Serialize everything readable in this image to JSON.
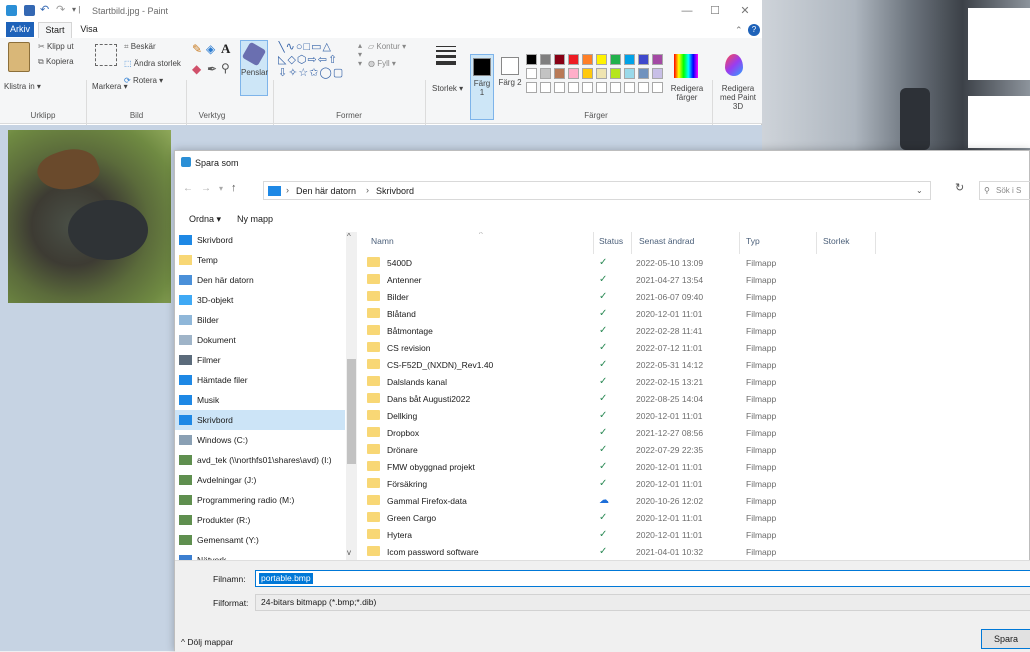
{
  "app": {
    "title": "Startbild.jpg - Paint"
  },
  "menu": {
    "tabs": [
      "Arkiv",
      "Start",
      "Visa"
    ]
  },
  "ribbon": {
    "klistra": "Klistra in ▾",
    "klipp_ut": "Klipp ut",
    "kopiera": "Kopiera",
    "markera": "Markera ▾",
    "beskar": "Beskär",
    "andra_storlek": "Ändra storlek",
    "rotera": "Rotera ▾",
    "penslar": "Penslar",
    "kontur": "Kontur ▾",
    "fyll": "Fyll ▾",
    "storlek": "Storlek ▾",
    "farg1": "Färg 1",
    "farg2": "Färg 2",
    "redigera_farger": "Redigera färger",
    "redigera_3d": "Redigera med Paint 3D",
    "groups": {
      "urklipp": "Urklipp",
      "bild": "Bild",
      "verktyg": "Verktyg",
      "former": "Former",
      "farger": "Färger"
    },
    "palette": [
      "#000000",
      "#7f7f7f",
      "#880015",
      "#ed1c24",
      "#ff7f27",
      "#fff200",
      "#22b14c",
      "#00a2e8",
      "#3f48cc",
      "#a349a4",
      "#ffffff",
      "#c3c3c3",
      "#b97a57",
      "#ffaec9",
      "#ffc90e",
      "#efe4b0",
      "#b5e61d",
      "#99d9ea",
      "#7092be",
      "#c8bfe7"
    ]
  },
  "dialog": {
    "title": "Spara som",
    "breadcrumb": [
      "Den här datorn",
      "Skrivbord"
    ],
    "search_placeholder": "Sök i S",
    "cmd": {
      "ordna": "Ordna ▾",
      "ny_mapp": "Ny mapp"
    },
    "nav": [
      {
        "label": "Skrivbord",
        "icon": "desktop-icon",
        "color": "#1e88e5",
        "sel": false
      },
      {
        "label": "Temp",
        "icon": "folder-icon",
        "color": "#f8d775",
        "sel": false
      },
      {
        "label": "Den här datorn",
        "icon": "computer-icon",
        "color": "#4a90d9",
        "sel": false
      },
      {
        "label": "3D-objekt",
        "icon": "cube-icon",
        "color": "#3fa9f5",
        "sel": false
      },
      {
        "label": "Bilder",
        "icon": "pictures-icon",
        "color": "#8fb7d9",
        "sel": false
      },
      {
        "label": "Dokument",
        "icon": "document-icon",
        "color": "#9fb4c8",
        "sel": false
      },
      {
        "label": "Filmer",
        "icon": "film-icon",
        "color": "#5b6b7b",
        "sel": false
      },
      {
        "label": "Hämtade filer",
        "icon": "download-icon",
        "color": "#1e88e5",
        "sel": false
      },
      {
        "label": "Musik",
        "icon": "music-icon",
        "color": "#1e88e5",
        "sel": false
      },
      {
        "label": "Skrivbord",
        "icon": "desktop-icon",
        "color": "#1e88e5",
        "sel": true
      },
      {
        "label": "Windows (C:)",
        "icon": "drive-icon",
        "color": "#8aa0b4",
        "sel": false
      },
      {
        "label": "avd_tek (\\\\northfs01\\shares\\avd) (I:)",
        "icon": "network-drive-icon",
        "color": "#5f8f4f",
        "sel": false
      },
      {
        "label": "Avdelningar (J:)",
        "icon": "network-drive-icon",
        "color": "#5f8f4f",
        "sel": false
      },
      {
        "label": "Programmering radio (M:)",
        "icon": "network-drive-icon",
        "color": "#5f8f4f",
        "sel": false
      },
      {
        "label": "Produkter (R:)",
        "icon": "network-drive-icon",
        "color": "#5f8f4f",
        "sel": false
      },
      {
        "label": "Gemensamt (Y:)",
        "icon": "network-drive-icon",
        "color": "#5f8f4f",
        "sel": false
      },
      {
        "label": "Nätverk",
        "icon": "network-icon",
        "color": "#3c7fd0",
        "sel": false
      }
    ],
    "columns": [
      "Namn",
      "Status",
      "Senast ändrad",
      "Typ",
      "Storlek"
    ],
    "files": [
      {
        "name": "5400D",
        "status": "✓",
        "date": "2022-05-10 13:09",
        "type": "Filmapp"
      },
      {
        "name": "Antenner",
        "status": "✓",
        "date": "2021-04-27 13:54",
        "type": "Filmapp"
      },
      {
        "name": "Bilder",
        "status": "✓",
        "date": "2021-06-07 09:40",
        "type": "Filmapp"
      },
      {
        "name": "Blåtand",
        "status": "✓",
        "date": "2020-12-01 11:01",
        "type": "Filmapp"
      },
      {
        "name": "Båtmontage",
        "status": "✓",
        "date": "2022-02-28 11:41",
        "type": "Filmapp"
      },
      {
        "name": "CS revision",
        "status": "✓",
        "date": "2022-07-12 11:01",
        "type": "Filmapp"
      },
      {
        "name": "CS-F52D_(NXDN)_Rev1.40",
        "status": "✓",
        "date": "2022-05-31 14:12",
        "type": "Filmapp"
      },
      {
        "name": "Dalslands kanal",
        "status": "✓",
        "date": "2022-02-15 13:21",
        "type": "Filmapp"
      },
      {
        "name": "Dans båt Augusti2022",
        "status": "✓",
        "date": "2022-08-25 14:04",
        "type": "Filmapp"
      },
      {
        "name": "Dellking",
        "status": "✓",
        "date": "2020-12-01 11:01",
        "type": "Filmapp"
      },
      {
        "name": "Dropbox",
        "status": "✓",
        "date": "2021-12-27 08:56",
        "type": "Filmapp"
      },
      {
        "name": "Drönare",
        "status": "✓",
        "date": "2022-07-29 22:35",
        "type": "Filmapp"
      },
      {
        "name": "FMW obyggnad projekt",
        "status": "✓",
        "date": "2020-12-01 11:01",
        "type": "Filmapp"
      },
      {
        "name": "Försäkring",
        "status": "✓",
        "date": "2020-12-01 11:01",
        "type": "Filmapp"
      },
      {
        "name": "Gammal Firefox-data",
        "status": "☁",
        "date": "2020-10-26 12:02",
        "type": "Filmapp"
      },
      {
        "name": "Green Cargo",
        "status": "✓",
        "date": "2020-12-01 11:01",
        "type": "Filmapp"
      },
      {
        "name": "Hytera",
        "status": "✓",
        "date": "2020-12-01 11:01",
        "type": "Filmapp"
      },
      {
        "name": "Icom password software",
        "status": "✓",
        "date": "2021-04-01 10:32",
        "type": "Filmapp"
      }
    ],
    "filename_label": "Filnamn:",
    "filename_value": "portable.bmp",
    "filetype_label": "Filformat:",
    "filetype_value": "24-bitars bitmapp (*.bmp;*.dib)",
    "hide_folders": "Dölj mappar",
    "save": "Spara"
  }
}
